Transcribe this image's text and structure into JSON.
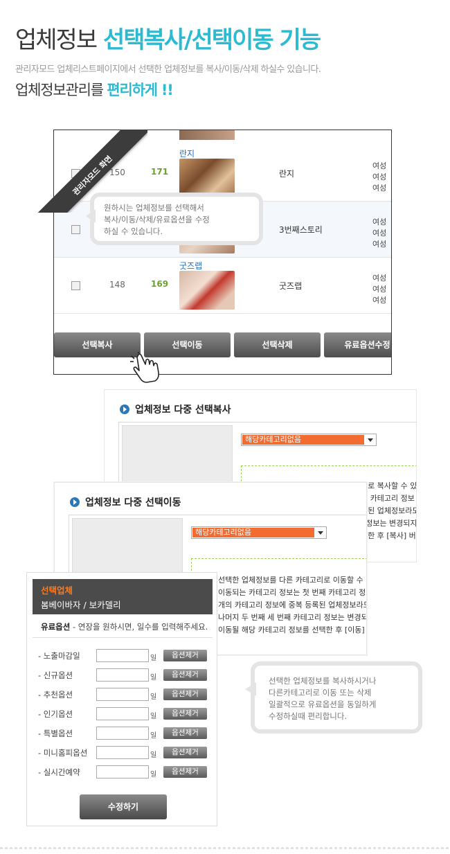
{
  "header": {
    "title_part1": "업체정보",
    "title_part2": "선택복사/선택이동 기능",
    "description": "관리자모드 업체리스트페이지에서 선택한 업체정보를 복사/이동/삭제 하실수 있습니다.",
    "subtitle_part1": "업체정보관리를",
    "subtitle_part2": "편리하게 !!"
  },
  "ribbon": {
    "label": "관리자모드 화면"
  },
  "list": {
    "rows": [
      {
        "num": "150",
        "count": "171",
        "title": "란지",
        "name": "란지",
        "tags": [
          "여성",
          "여성",
          "여성"
        ]
      },
      {
        "num": "",
        "count": "",
        "title": "",
        "name": "3번째스토리",
        "tags": [
          "여성",
          "여성",
          "여성"
        ]
      },
      {
        "num": "148",
        "count": "169",
        "title": "굿즈랩",
        "name": "굿즈랩",
        "tags": [
          "여성",
          "여성",
          "여성"
        ]
      }
    ],
    "buttons": [
      "선택복사",
      "선택이동",
      "선택삭제",
      "유료옵션수정"
    ]
  },
  "bubble1": {
    "lines": [
      "원하시는 업체정보를 선택해서",
      "복사/이동/삭제/유료옵션을 수정",
      "하실 수 있습니다."
    ]
  },
  "copy_panel": {
    "title": "업체정보 다중 선택복사",
    "select_value": "해당카테고리없음",
    "desc_lines": [
      "리로 복사할 수 있",
      "째 카테고리 정보",
      "록된 업체정보라도",
      "| 정보는 변경되지",
      "택한 후 [복사] 버"
    ]
  },
  "move_panel": {
    "title": "업체정보 다중 선택이동",
    "select_value": "해당카테고리없음",
    "desc_lines": [
      "선택한 업체정보를 다른 카테고리로 이동할 수 있",
      "이동되는 카테고리 정보는 첫 번째 카테고리 정보",
      "개의 카테고리 정보에 중복 등록된 업체정보라도",
      "나머지 두 번째 세 번째 카테고리 정보는 변경되지",
      "이동될 해당 카테고리 정보를 선택한 후 [이동] 버"
    ]
  },
  "options_panel": {
    "label": "선택업체",
    "company": "봄베이바자 / 보카델리",
    "info_label": "유료옵션",
    "info_text": " - 연장을 원하시면, 일수를 입력해주세요.",
    "unit": "일",
    "remove_label": "옵션제거",
    "rows": [
      "- 노출마감일",
      "- 신규옵션",
      "- 추천옵션",
      "- 인기옵션",
      "- 특별옵션",
      "- 미니홈피옵션",
      "- 실시간예약"
    ],
    "submit": "수정하기"
  },
  "bubble2": {
    "lines": [
      "선택한 업체정보를 복사하시거나",
      "다른카테고리로 이동 또는 삭제",
      "일괄적으로 유료옵션을 동일하게",
      "수정하실때 편리합니다."
    ]
  },
  "colors": {
    "accent": "#2bbad1",
    "orange": "#f26b30",
    "green": "#6aa12c",
    "link": "#1a6fc4"
  }
}
